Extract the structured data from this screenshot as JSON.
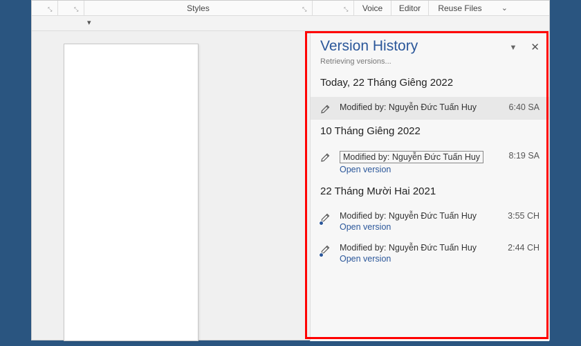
{
  "ribbon": {
    "styles_label": "Styles",
    "voice_label": "Voice",
    "editor_label": "Editor",
    "reuse_label": "Reuse Files"
  },
  "panel": {
    "title": "Version History",
    "subtitle": "Retrieving versions...",
    "open_version_label": "Open version",
    "modified_prefix": "Modified by:",
    "groups": [
      {
        "heading": "Today, 22 Tháng Giêng 2022",
        "items": [
          {
            "author": "Nguyễn Đức Tuấn Huy",
            "time": "6:40 SA",
            "selected": true,
            "link": false,
            "boxed": false,
            "autosave": false
          }
        ]
      },
      {
        "heading": "10 Tháng Giêng 2022",
        "items": [
          {
            "author": "Nguyễn Đức Tuấn Huy",
            "time": "8:19 SA",
            "selected": false,
            "link": true,
            "boxed": true,
            "autosave": false
          }
        ]
      },
      {
        "heading": "22 Tháng Mười Hai 2021",
        "items": [
          {
            "author": "Nguyễn Đức Tuấn Huy",
            "time": "3:55 CH",
            "selected": false,
            "link": true,
            "boxed": false,
            "autosave": true
          },
          {
            "author": "Nguyễn Đức Tuấn Huy",
            "time": "2:44 CH",
            "selected": false,
            "link": true,
            "boxed": false,
            "autosave": true
          }
        ]
      }
    ]
  }
}
